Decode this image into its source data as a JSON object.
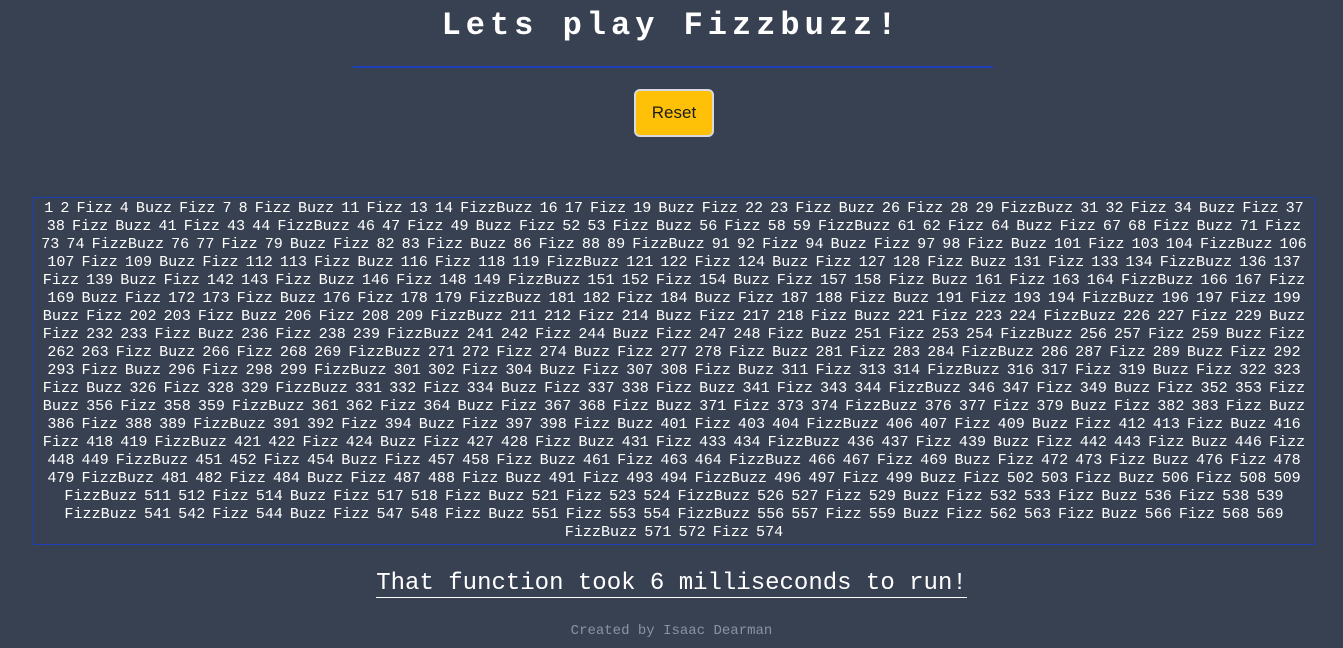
{
  "header": {
    "title": "Lets play Fizzbuzz!"
  },
  "controls": {
    "reset_label": "Reset"
  },
  "output": {
    "start": 1,
    "fizz_word": "Fizz",
    "buzz_word": "Buzz",
    "fizzbuzz_word": "FizzBuzz",
    "sequence_text": "1 2 Fizz 4 Buzz Fizz 7 8 Fizz Buzz 11 Fizz 13 14 FizzBuzz 16 17 Fizz 19 Buzz Fizz 22 23 Fizz Buzz 26 Fizz 28 29 FizzBuzz 31 32 Fizz 34 Buzz Fizz 37 38 Fizz Buzz 41 Fizz 43 44 FizzBuzz 46 47 Fizz 49 Buzz Fizz 52 53 Fizz Buzz 56 Fizz 58 59 FizzBuzz 61 62 Fizz 64 Buzz Fizz 67 68 Fizz Buzz 71 Fizz 73 74 FizzBuzz 76 77 Fizz 79 Buzz Fizz 82 83 Fizz Buzz 86 Fizz 88 89 FizzBuzz 91 92 Fizz 94 Buzz Fizz 97 98 Fizz Buzz 101 Fizz 103 104 FizzBuzz 106 107 Fizz 109 Buzz Fizz 112 113 Fizz Buzz 116 Fizz 118 119 FizzBuzz 121 122 Fizz 124 Buzz Fizz 127 128 Fizz Buzz 131 Fizz 133 134 FizzBuzz 136 137 Fizz 139 Buzz Fizz 142 143 Fizz Buzz 146 Fizz 148 149 FizzBuzz 151 152 Fizz 154 Buzz Fizz 157 158 Fizz Buzz 161 Fizz 163 164 FizzBuzz 166 167 Fizz 169 Buzz Fizz 172 173 Fizz Buzz 176 Fizz 178 179 FizzBuzz 181 182 Fizz 184 Buzz Fizz 187 188 Fizz Buzz 191 Fizz 193 194 FizzBuzz 196 197 Fizz 199 Buzz Fizz 202 203 Fizz Buzz 206 Fizz 208 209 FizzBuzz 211 212 Fizz 214 Buzz Fizz 217 218 Fizz Buzz 221 Fizz 223 224 FizzBuzz 226 227 Fizz 229 Buzz Fizz 232 233 Fizz Buzz 236 Fizz 238 239 FizzBuzz 241 242 Fizz 244 Buzz Fizz 247 248 Fizz Buzz 251 Fizz 253 254 FizzBuzz 256 257 Fizz 259 Buzz Fizz 262 263 Fizz Buzz 266 Fizz 268 269 FizzBuzz 271 272 Fizz 274 Buzz Fizz 277 278 Fizz Buzz 281 Fizz 283 284 FizzBuzz 286 287 Fizz 289 Buzz Fizz 292 293 Fizz Buzz 296 Fizz 298 299 FizzBuzz 301 302 Fizz 304 Buzz Fizz 307 308 Fizz Buzz 311 Fizz 313 314 FizzBuzz 316 317 Fizz 319 Buzz Fizz 322 323 Fizz Buzz 326 Fizz 328 329 FizzBuzz 331 332 Fizz 334 Buzz Fizz 337 338 Fizz Buzz 341 Fizz 343 344 FizzBuzz 346 347 Fizz 349 Buzz Fizz 352 353 Fizz Buzz 356 Fizz 358 359 FizzBuzz 361 362 Fizz 364 Buzz Fizz 367 368 Fizz Buzz 371 Fizz 373 374 FizzBuzz 376 377 Fizz 379 Buzz Fizz 382 383 Fizz Buzz 386 Fizz 388 389 FizzBuzz 391 392 Fizz 394 Buzz Fizz 397 398 Fizz Buzz 401 Fizz 403 404 FizzBuzz 406 407 Fizz 409 Buzz Fizz 412 413 Fizz Buzz 416 Fizz 418 419 FizzBuzz 421 422 Fizz 424 Buzz Fizz 427 428 Fizz Buzz 431 Fizz 433 434 FizzBuzz 436 437 Fizz 439 Buzz Fizz 442 443 Fizz Buzz 446 Fizz 448 449 FizzBuzz 451 452 Fizz 454 Buzz Fizz 457 458 Fizz Buzz 461 Fizz 463 464 FizzBuzz 466 467 Fizz 469 Buzz Fizz 472 473 Fizz Buzz 476 Fizz 478 479 FizzBuzz 481 482 Fizz 484 Buzz Fizz 487 488 Fizz Buzz 491 Fizz 493 494 FizzBuzz 496 497 Fizz 499 Buzz Fizz 502 503 Fizz Buzz 506 Fizz 508 509 FizzBuzz 511 512 Fizz 514 Buzz Fizz 517 518 Fizz Buzz 521 Fizz 523 524 FizzBuzz 526 527 Fizz 529 Buzz Fizz 532 533 Fizz Buzz 536 Fizz 538 539 FizzBuzz 541 542 Fizz 544 Buzz Fizz 547 548 Fizz Buzz 551 Fizz 553 554 FizzBuzz 556 557 Fizz 559 Buzz Fizz 562 563 Fizz Buzz 566 Fizz 568 569 FizzBuzz 571 572 Fizz 574"
  },
  "result": {
    "timing_text": "That function took 6 milliseconds to run!"
  },
  "footer": {
    "credit": "Created by Isaac Dearman"
  },
  "colors": {
    "background": "#384152",
    "accent_line": "#1f3fb8",
    "button": "#ffc107",
    "footer_text": "#8a93a3"
  }
}
